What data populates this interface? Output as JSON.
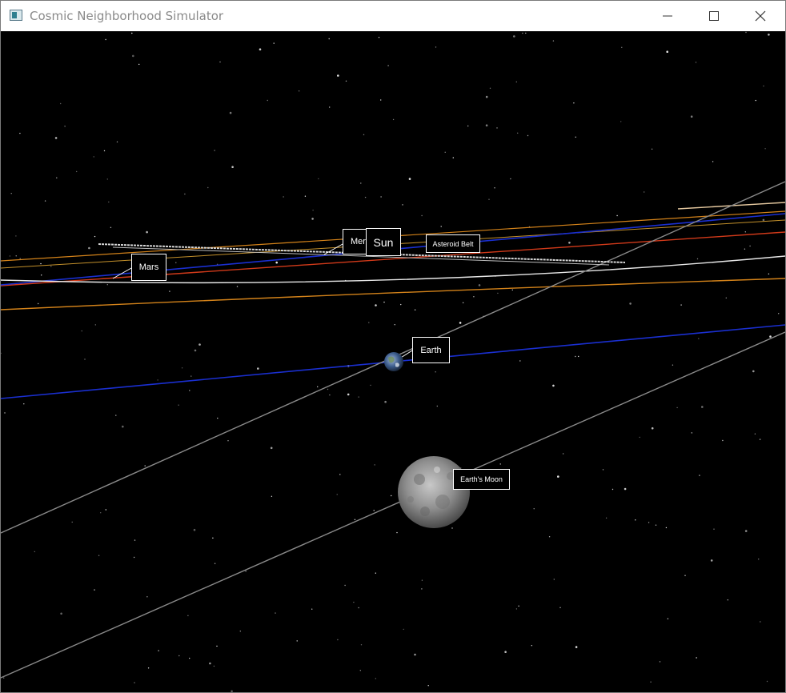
{
  "window": {
    "title": "Cosmic Neighborhood Simulator"
  },
  "controls": {
    "minimize_icon": "minimize-icon",
    "maximize_icon": "maximize-icon",
    "close_icon": "close-icon"
  },
  "labels": {
    "mercury": "Mer",
    "sun": "Sun",
    "asteroid_belt": "Asteroid Belt",
    "mars": "Mars",
    "earth": "Earth",
    "moon": "Earth's Moon"
  },
  "colors": {
    "space": "#000000",
    "earth_orbit": "#1a2fd0",
    "mars_orbit": "#d23a1a",
    "outer_orbit": "#d4831a",
    "moon_orbit": "#8a8a8a",
    "belt": "#d8d8d8"
  }
}
